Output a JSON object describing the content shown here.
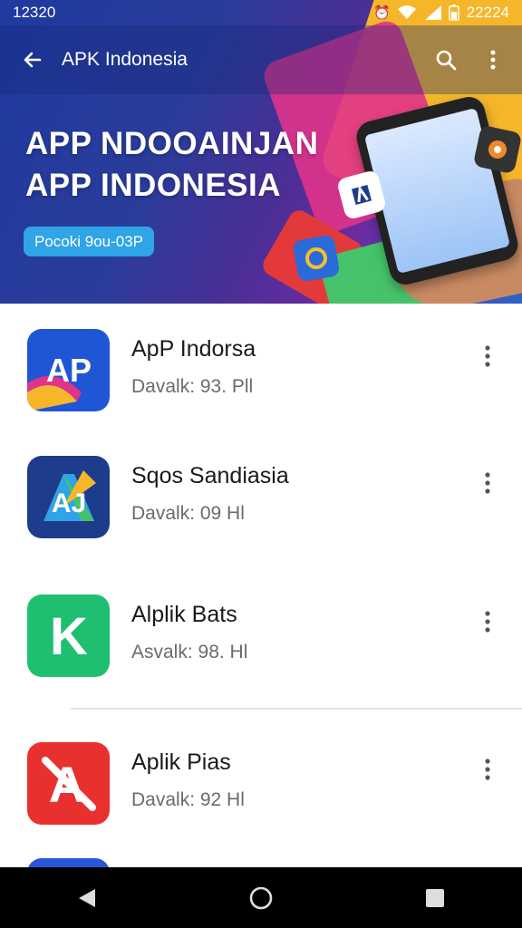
{
  "status_bar": {
    "time": "12320",
    "right_time": "22224"
  },
  "app_bar": {
    "title": "APK Indonesia"
  },
  "hero": {
    "title_line1": "APP NDOOAINJAN",
    "title_line2": "APP INDONESIA",
    "pill_text": "Pocoki 9ou-03P"
  },
  "apps": [
    {
      "name": "ApP Indorsa",
      "sub": "Davalk: 93. Pll",
      "icon_label": "AP",
      "icon_color": "#1e56d6"
    },
    {
      "name": "Sqos Sandiasia",
      "sub": "Davalk: 09 Hl",
      "icon_label": "AJ",
      "icon_color": "#1d3c8c"
    },
    {
      "name": "Alplik Bats",
      "sub": "Asvalk: 98. Hl",
      "icon_label": "K",
      "icon_color": "#1fbf72"
    },
    {
      "name": "Aplik Pias",
      "sub": "Davalk: 92 Hl",
      "icon_label": "A",
      "icon_color": "#e8302f"
    }
  ]
}
